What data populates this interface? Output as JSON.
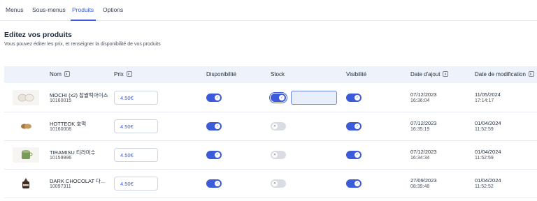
{
  "tabs": [
    {
      "label": "Menus"
    },
    {
      "label": "Sous-menus"
    },
    {
      "label": "Produits"
    },
    {
      "label": "Options"
    }
  ],
  "active_tab": "Produits",
  "section": {
    "title": "Editez vos produits",
    "subtitle": "Vous pouvez éditer les prix, et renseigner la disponibilité de vos produits"
  },
  "table": {
    "columns": {
      "nom": "Nom",
      "prix": "Prix",
      "disponibilite": "Disponibilité",
      "stock": "Stock",
      "visibilite": "Visibilité",
      "date_ajout": "Date d'ajout",
      "date_modification": "Date de modification"
    },
    "rows": [
      {
        "name": "MOCHI (x2) 찹쌀떡아이스",
        "code": "10160015",
        "price": "4.50€",
        "available": true,
        "stock": true,
        "visible": true,
        "added_date": "07/12/2023",
        "added_time": "16:36:04",
        "modified_date": "11/05/2024",
        "modified_time": "17:14:17",
        "image_icon": "mochi-image"
      },
      {
        "name": "HOTTEOK 호떡",
        "code": "10160008",
        "price": "4.50€",
        "available": true,
        "stock": false,
        "visible": true,
        "added_date": "07/12/2023",
        "added_time": "16:35:19",
        "modified_date": "01/04/2024",
        "modified_time": "11:52:59",
        "image_icon": "hotteok-image"
      },
      {
        "name": "TIRAMISU 티라미수",
        "code": "10159996",
        "price": "4.50€",
        "available": true,
        "stock": false,
        "visible": true,
        "added_date": "07/12/2023",
        "added_time": "16:34:34",
        "modified_date": "01/04/2024",
        "modified_time": "11:52:59",
        "image_icon": "tiramisu-image"
      },
      {
        "name": "DARK CHOCOLAT 다...",
        "code": "10097311",
        "price": "4.50€",
        "available": true,
        "stock": false,
        "visible": true,
        "added_date": "27/09/2023",
        "added_time": "08:39:48",
        "modified_date": "01/04/2024",
        "modified_time": "11:52:52",
        "image_icon": "dark-chocolat-image"
      }
    ]
  },
  "colors": {
    "accent": "#3b5bdb",
    "header_bg": "#eef2fb",
    "toggle_off": "#d9dce3"
  }
}
